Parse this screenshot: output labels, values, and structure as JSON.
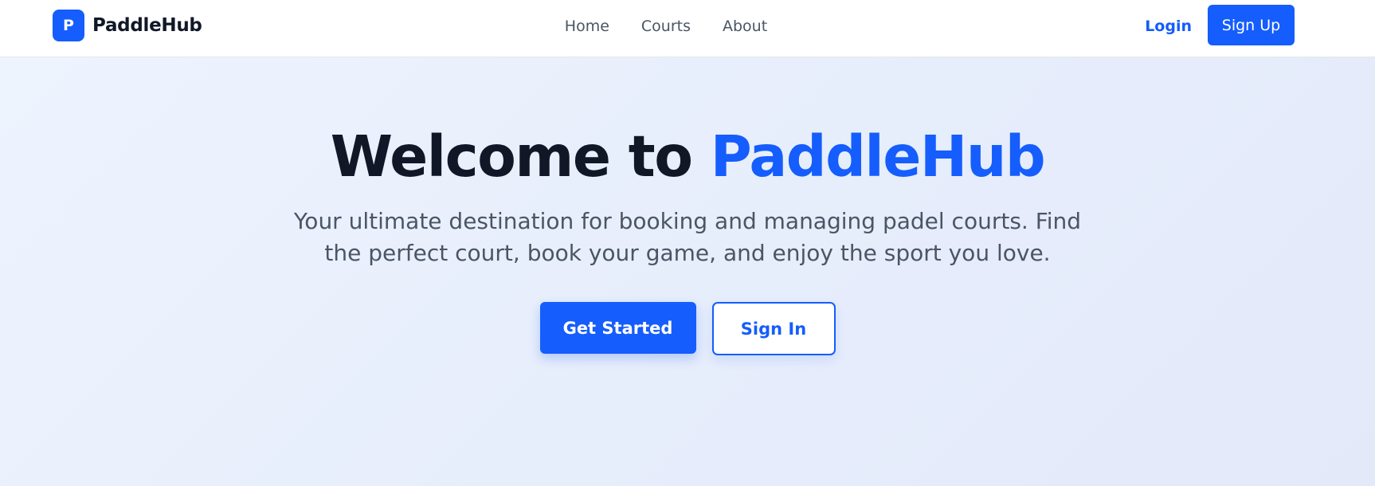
{
  "nav": {
    "brand_letter": "P",
    "brand_name": "PaddleHub",
    "links": [
      {
        "label": "Home"
      },
      {
        "label": "Courts"
      },
      {
        "label": "About"
      }
    ],
    "login_label": "Login",
    "signup_label": "Sign Up"
  },
  "hero": {
    "title_prefix": "Welcome to ",
    "title_accent": "PaddleHub",
    "subtitle": "Your ultimate destination for booking and managing padel courts. Find the perfect court, book your game, and enjoy the sport you love.",
    "primary_button": "Get Started",
    "secondary_button": "Sign In"
  },
  "colors": {
    "accent": "#155dfc",
    "heading": "#101828",
    "muted_text": "#4a5565",
    "hero_bg": "#e8eefc"
  }
}
